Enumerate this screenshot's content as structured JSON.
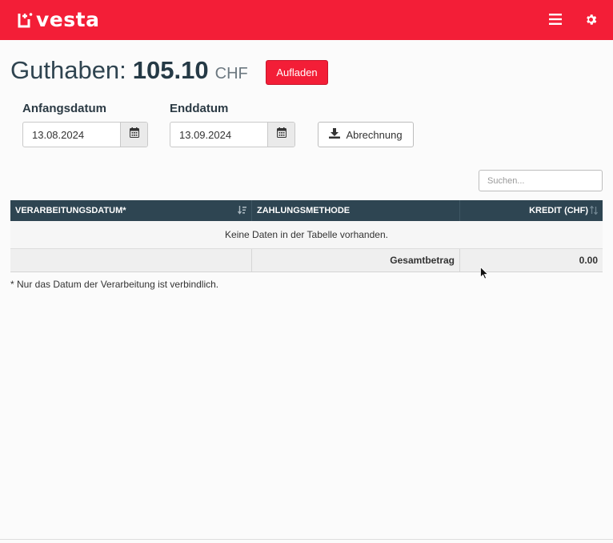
{
  "header": {
    "brand": "vesta",
    "icons": {
      "logo": "vesta-logo-icon",
      "menu": "hamburger-menu-icon",
      "settings": "gear-icon"
    },
    "color": "#f31e37"
  },
  "balance": {
    "label": "Guthaben:",
    "amount": "105.10",
    "currency": "CHF",
    "topup_label": "Aufladen"
  },
  "filters": {
    "start_label": "Anfangsdatum",
    "start_value": "13.08.2024",
    "end_label": "Enddatum",
    "end_value": "13.09.2024",
    "calendar_icon": "calendar-icon",
    "export_label": "Abrechnung",
    "export_icon": "download-icon"
  },
  "search": {
    "placeholder": "Suchen..."
  },
  "table": {
    "columns": [
      "VERARBEITUNGSDATUM*",
      "ZAHLUNGSMETHODE",
      "KREDIT (CHF)"
    ],
    "empty_text": "Keine Daten in der Tabelle vorhanden.",
    "footer": {
      "total_label": "Gesamtbetrag",
      "total_value": "0.00"
    },
    "header_color": "#2e4552"
  },
  "footnote": "* Nur das Datum der Verarbeitung ist verbindlich."
}
